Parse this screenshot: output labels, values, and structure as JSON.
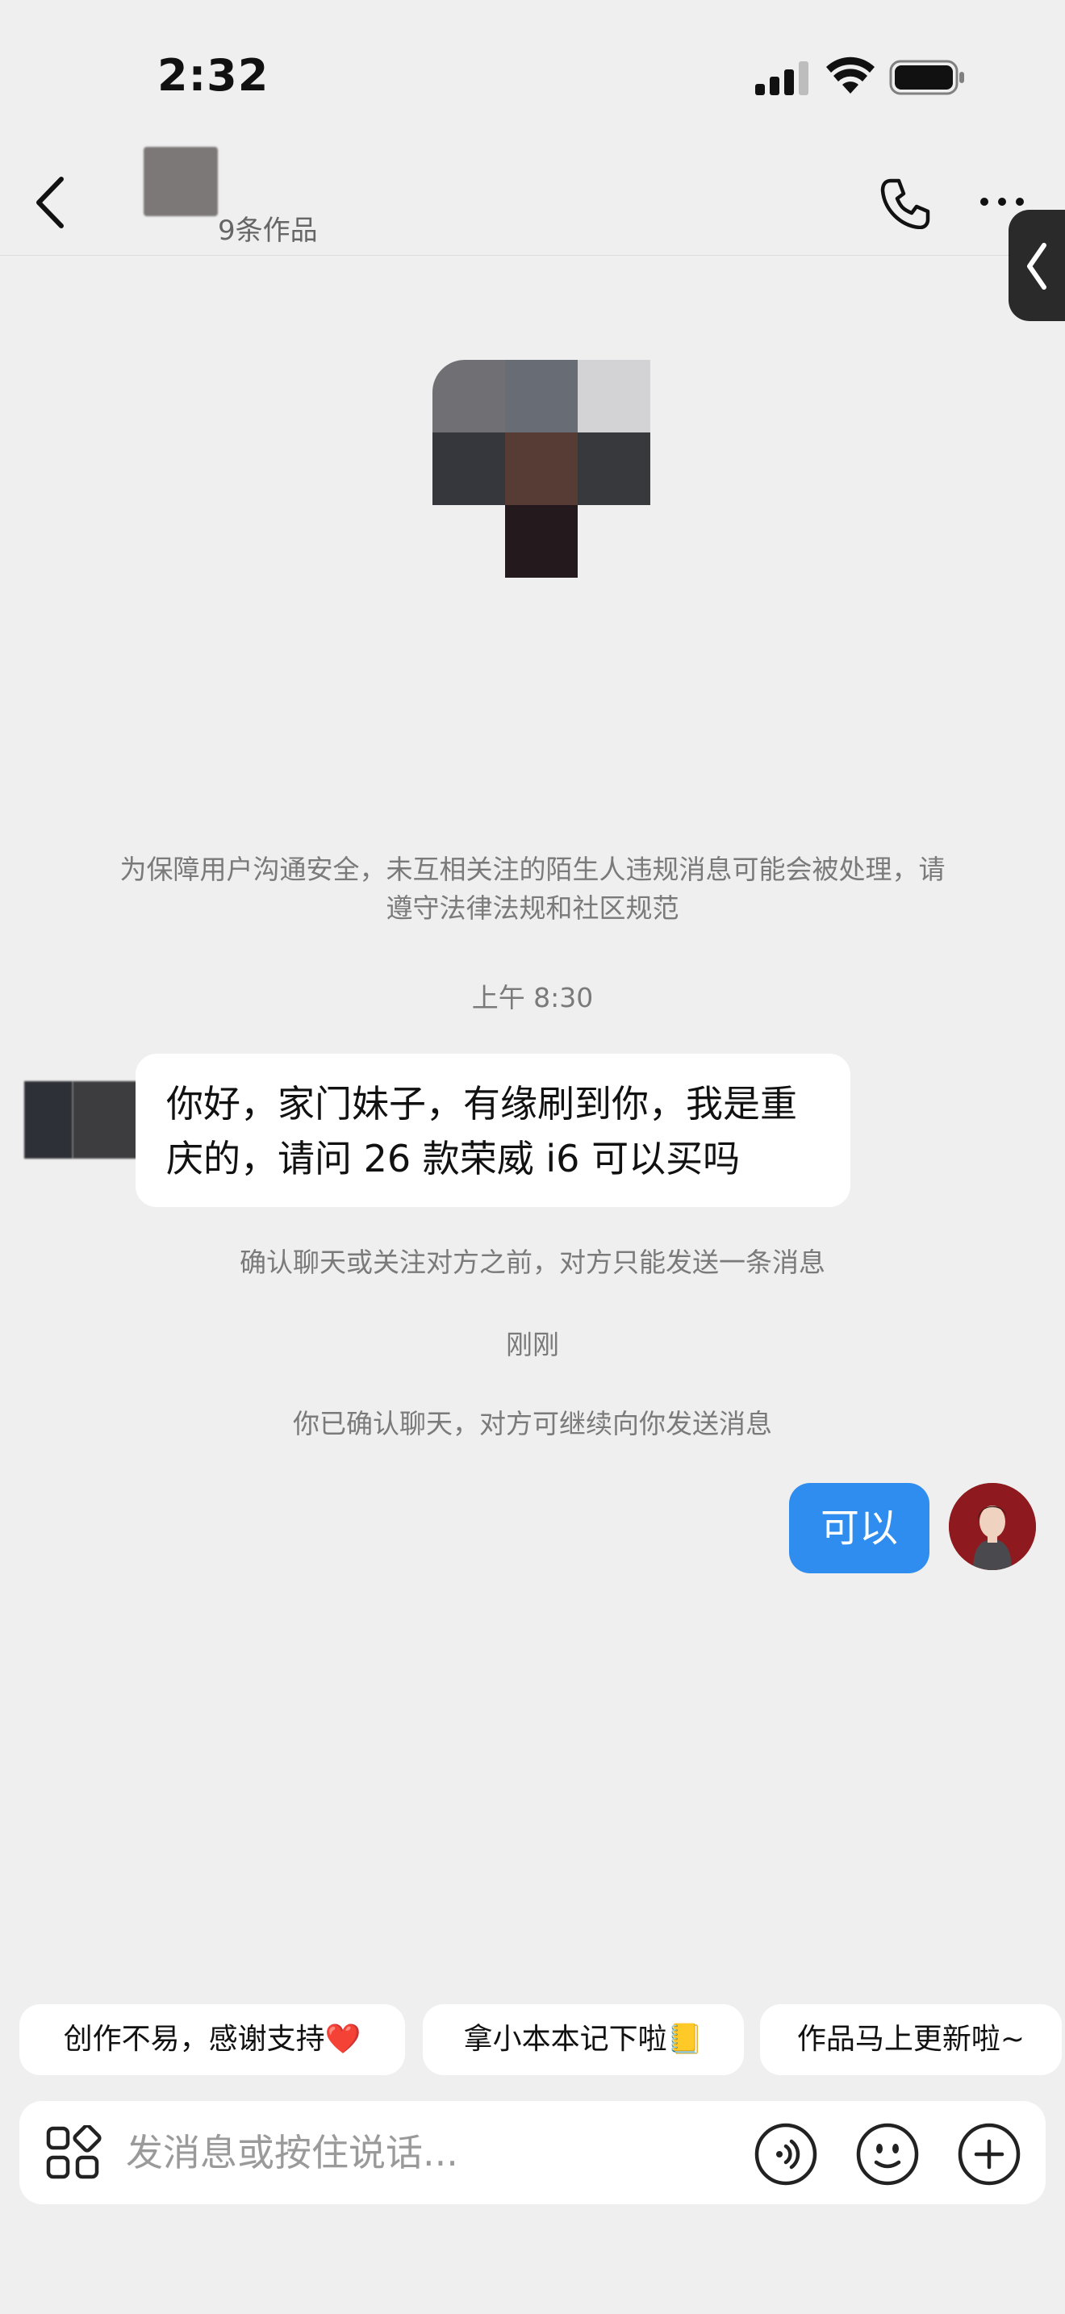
{
  "status_bar": {
    "time": "2:32"
  },
  "header": {
    "works_count": "9条作品"
  },
  "system": {
    "safety_notice": "为保障用户沟通安全，未互相关注的陌生人违规消息可能会被处理，请遵守法律法规和社区规范",
    "time_1": "上午 8:30",
    "confirm_notice": "确认聊天或关注对方之前，对方只能发送一条消息",
    "time_2": "刚刚",
    "confirmed_notice": "你已确认聊天，对方可继续向你发送消息"
  },
  "messages": {
    "incoming": "你好，家门妹子，有缘刷到你，我是重庆的，请问 26 款荣威 i6 可以买吗",
    "outgoing": "可以"
  },
  "quick_replies": [
    "创作不易，感谢支持❤️",
    "拿小本本记下啦📒",
    "作品马上更新啦~"
  ],
  "input": {
    "placeholder": "发消息或按住说话..."
  },
  "colors": {
    "accent": "#2f8df0",
    "background": "#efefef",
    "bubble": "#ffffff"
  },
  "icons": [
    "back-icon",
    "phone-icon",
    "more-icon",
    "apps-icon",
    "voice-icon",
    "emoji-icon",
    "plus-icon"
  ]
}
